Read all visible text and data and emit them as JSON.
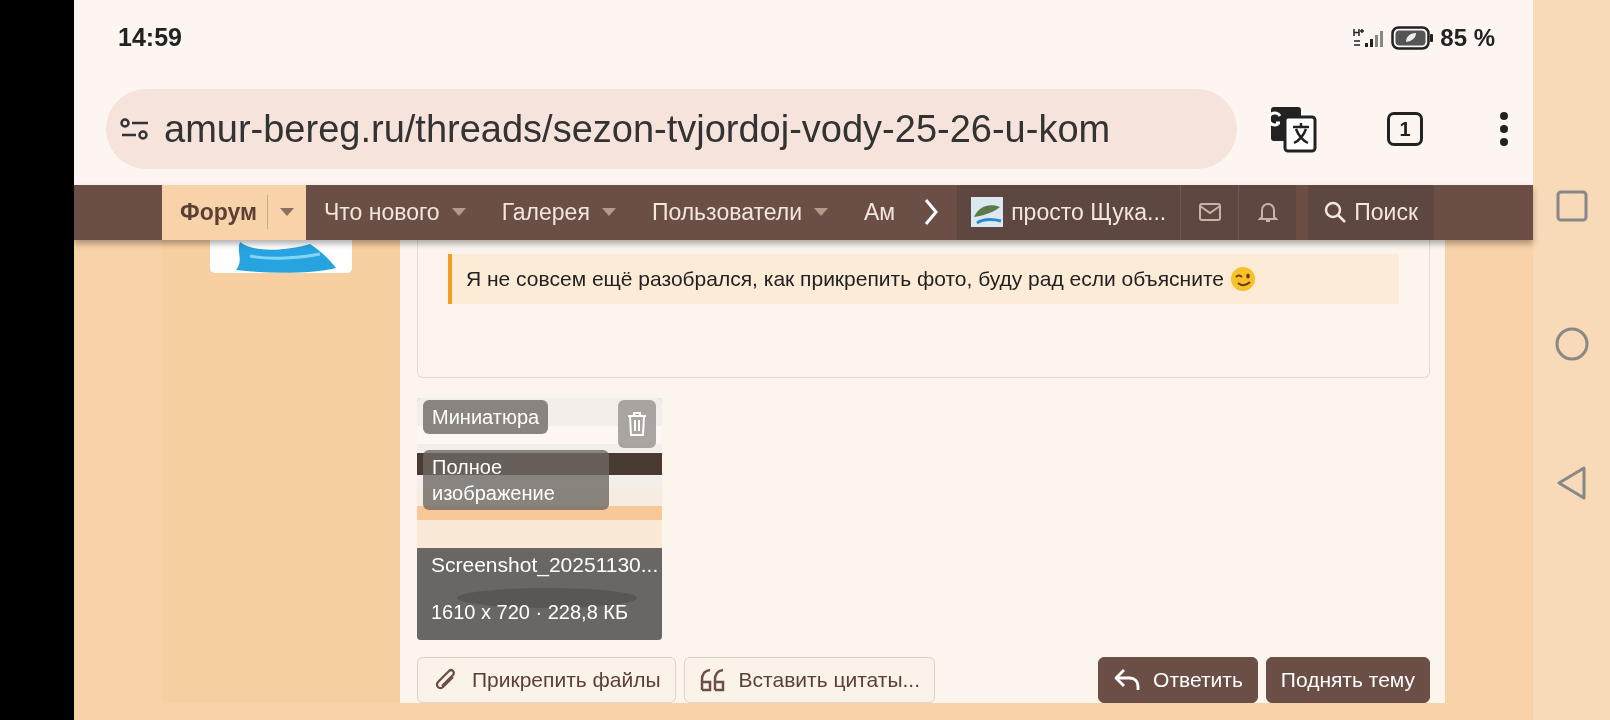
{
  "status_bar": {
    "time": "14:59",
    "battery": "85 %"
  },
  "browser": {
    "url": "amur-bereg.ru/threads/sezon-tvjordoj-vody-25-26-u-kom",
    "tab_count": "1"
  },
  "nav": {
    "items": [
      {
        "label": "Форум",
        "selected": true,
        "dropdown": true
      },
      {
        "label": "Что нового",
        "selected": false,
        "dropdown": true
      },
      {
        "label": "Галерея",
        "selected": false,
        "dropdown": true
      },
      {
        "label": "Пользователи",
        "selected": false,
        "dropdown": true
      },
      {
        "label": "Ам",
        "selected": false,
        "dropdown": false
      }
    ],
    "user": "просто Щука...",
    "search": "Поиск"
  },
  "quote": {
    "text": "Я не совсем ещё разобрался, как прикрепить фото, буду рад если объясните"
  },
  "attachment": {
    "kind": "picture",
    "thumbnail_label": "Миниатюра",
    "full_label": "Полное изображение",
    "filename": "Screenshot_20251130...",
    "meta": "1610 x 720 · 228,8 КБ"
  },
  "buttons": [
    {
      "label": "Прикрепить файлы",
      "kind": "attach",
      "primary": false
    },
    {
      "label": "Вставить цитаты...",
      "kind": "quote",
      "primary": false
    },
    {
      "label": "Ответить",
      "kind": "reply",
      "primary": true
    },
    {
      "label": "Поднять тему",
      "kind": "plain",
      "primary": true
    }
  ]
}
